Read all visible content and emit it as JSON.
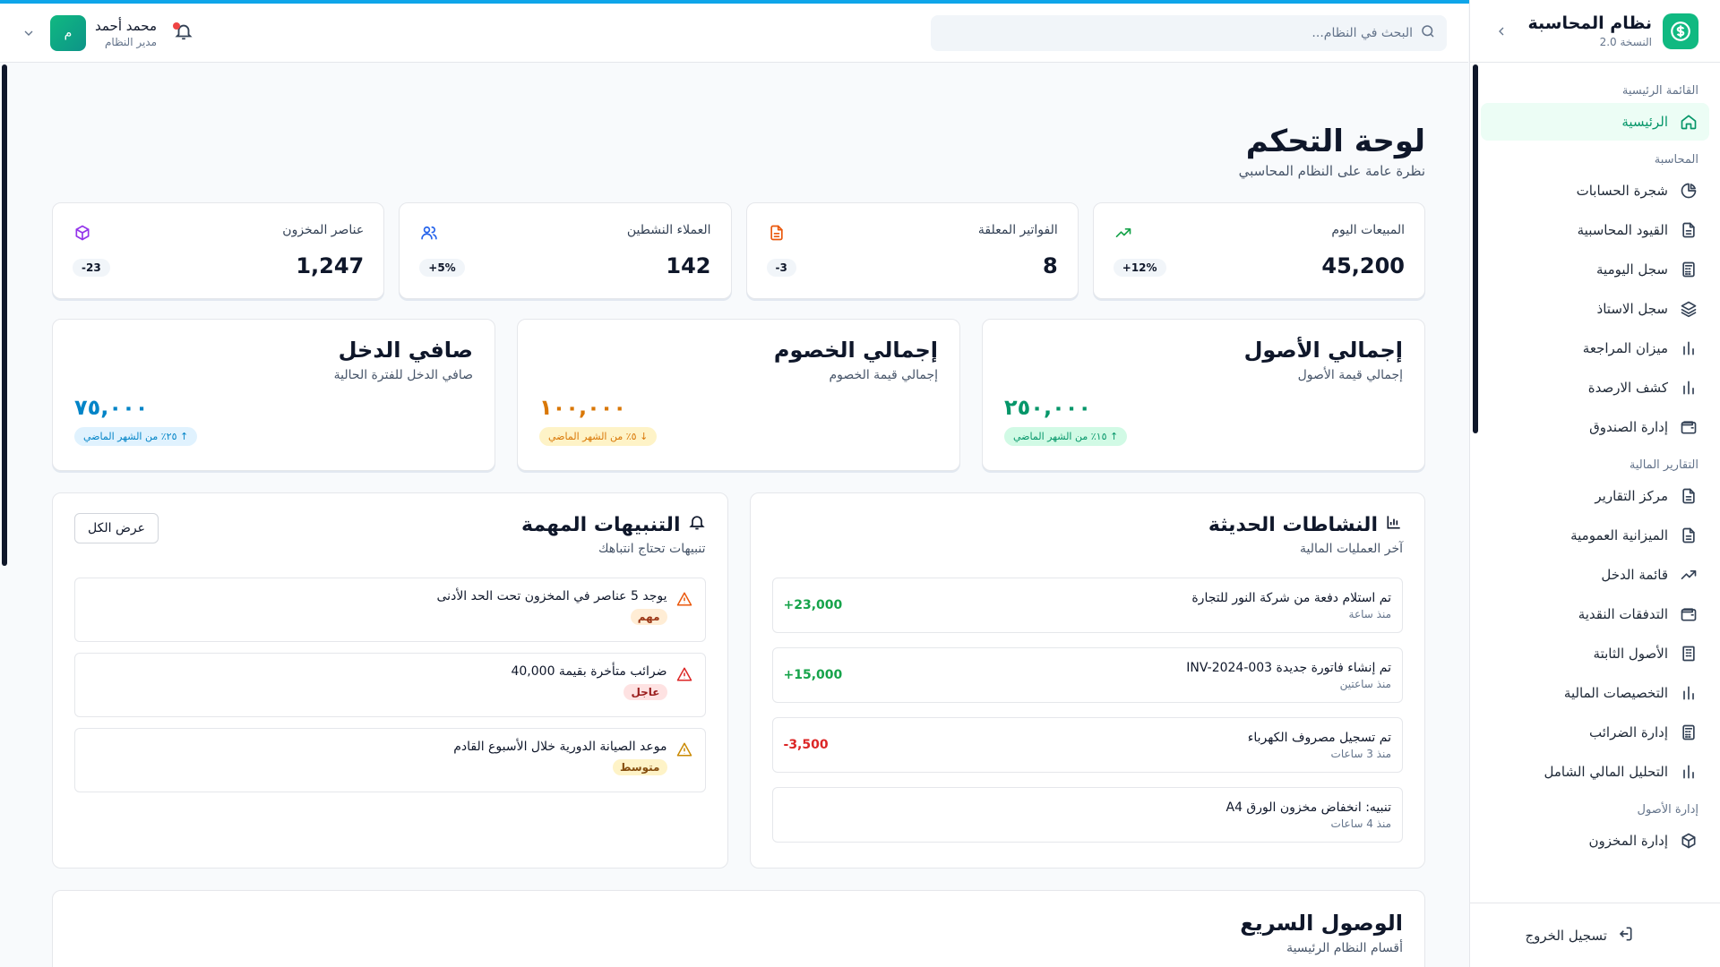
{
  "app": {
    "title": "نظام المحاسبة",
    "version": "النسخة 2.0",
    "accent": "#10b981",
    "progress_color": "#0ea5e9"
  },
  "header": {
    "search_placeholder": "البحث في النظام...",
    "user_name": "محمد أحمد",
    "user_role": "مدير النظام",
    "avatar_initial": "م",
    "notification_dot": "#ef4444"
  },
  "sidebar": {
    "sections": [
      {
        "title": "القائمة الرئيسية",
        "items": [
          {
            "label": "الرئيسية",
            "icon": "home-icon",
            "active": true
          }
        ]
      },
      {
        "title": "المحاسبة",
        "items": [
          {
            "label": "شجرة الحسابات",
            "icon": "pie-chart-icon"
          },
          {
            "label": "القيود المحاسبية",
            "icon": "document-icon"
          },
          {
            "label": "سجل اليومية",
            "icon": "calculator-icon"
          },
          {
            "label": "سجل الاستاذ",
            "icon": "layers-icon"
          },
          {
            "label": "ميزان المراجعة",
            "icon": "bar-chart-icon"
          },
          {
            "label": "كشف الارصدة",
            "icon": "bar-chart-icon"
          },
          {
            "label": "إدارة الصندوق",
            "icon": "wallet-icon"
          }
        ]
      },
      {
        "title": "التقارير المالية",
        "items": [
          {
            "label": "مركز التقارير",
            "icon": "document-icon"
          },
          {
            "label": "الميزانية العمومية",
            "icon": "document-icon"
          },
          {
            "label": "قائمة الدخل",
            "icon": "trending-up-icon"
          },
          {
            "label": "التدفقات النقدية",
            "icon": "wallet-icon"
          },
          {
            "label": "الأصول الثابتة",
            "icon": "building-icon"
          },
          {
            "label": "التخصيصات المالية",
            "icon": "bar-chart-icon"
          },
          {
            "label": "إدارة الضرائب",
            "icon": "calculator-icon"
          },
          {
            "label": "التحليل المالي الشامل",
            "icon": "bar-chart-icon"
          }
        ]
      },
      {
        "title": "إدارة الأصول",
        "items": [
          {
            "label": "إدارة المخزون",
            "icon": "package-icon"
          }
        ]
      }
    ],
    "logout_label": "تسجيل الخروج"
  },
  "page": {
    "title": "لوحة التحكم",
    "subtitle": "نظرة عامة على النظام المحاسبي"
  },
  "stats": [
    {
      "label": "المبيعات اليوم",
      "value": "45,200",
      "badge": "12%+",
      "icon": "trending-up-icon",
      "color": "#16a34a"
    },
    {
      "label": "الفواتير المعلقة",
      "value": "8",
      "badge": "3-",
      "icon": "document-icon",
      "color": "#ea580c"
    },
    {
      "label": "العملاء النشطين",
      "value": "142",
      "badge": "5%+",
      "icon": "users-icon",
      "color": "#2563eb"
    },
    {
      "label": "عناصر المخزون",
      "value": "1,247",
      "badge": "23-",
      "icon": "package-icon",
      "color": "#9333ea"
    }
  ],
  "summary": [
    {
      "title": "إجمالي الأصول",
      "subtitle": "إجمالي قيمة الأصول",
      "value": "٢٥٠,٠٠٠",
      "pill": "↑ ١٥٪ من الشهر الماضي",
      "color": "#059669",
      "pill_bg": "#d1fae5"
    },
    {
      "title": "إجمالي الخصوم",
      "subtitle": "إجمالي قيمة الخصوم",
      "value": "١٠٠,٠٠٠",
      "pill": "↓ ٥٪ من الشهر الماضي",
      "color": "#d97706",
      "pill_bg": "#fef3c7"
    },
    {
      "title": "صافي الدخل",
      "subtitle": "صافي الدخل للفترة الحالية",
      "value": "٧٥,٠٠٠",
      "pill": "↑ ٢٥٪ من الشهر الماضي",
      "color": "#0284c7",
      "pill_bg": "#e0f2fe"
    }
  ],
  "activities": {
    "title": "النشاطات الحديثة",
    "subtitle": "آخر العمليات المالية",
    "items": [
      {
        "title": "تم استلام دفعة من شركة النور للتجارة",
        "time": "منذ ساعة",
        "amount": "23,000+",
        "color": "#16a34a"
      },
      {
        "title": "تم إنشاء فاتورة جديدة INV-2024-003",
        "time": "منذ ساعتين",
        "amount": "15,000+",
        "color": "#16a34a"
      },
      {
        "title": "تم تسجيل مصروف الكهرباء",
        "time": "منذ 3 ساعات",
        "amount": "3,500-",
        "color": "#dc2626"
      },
      {
        "title": "تنبيه: انخفاض مخزون الورق A4",
        "time": "منذ 4 ساعات",
        "amount": "",
        "color": "#0f172a"
      }
    ]
  },
  "alerts": {
    "title": "التنبيهات المهمة",
    "subtitle": "تنبيهات تحتاج انتباهك",
    "view_all": "عرض الكل",
    "items": [
      {
        "text": "يوجد 5 عناصر في المخزون تحت الحد الأدنى",
        "tag": "مهم",
        "icon_color": "#ea580c",
        "tag_bg": "#ffedd5",
        "tag_color": "#9a3412"
      },
      {
        "text": "ضرائب متأخرة بقيمة 40,000",
        "tag": "عاجل",
        "icon_color": "#dc2626",
        "tag_bg": "#fee2e2",
        "tag_color": "#991b1b"
      },
      {
        "text": "موعد الصيانة الدورية خلال الأسبوع القادم",
        "tag": "متوسط",
        "icon_color": "#ca8a04",
        "tag_bg": "#fef3c7",
        "tag_color": "#854d0e"
      }
    ]
  },
  "quick": {
    "title": "الوصول السريع",
    "subtitle": "أقسام النظام الرئيسية"
  }
}
